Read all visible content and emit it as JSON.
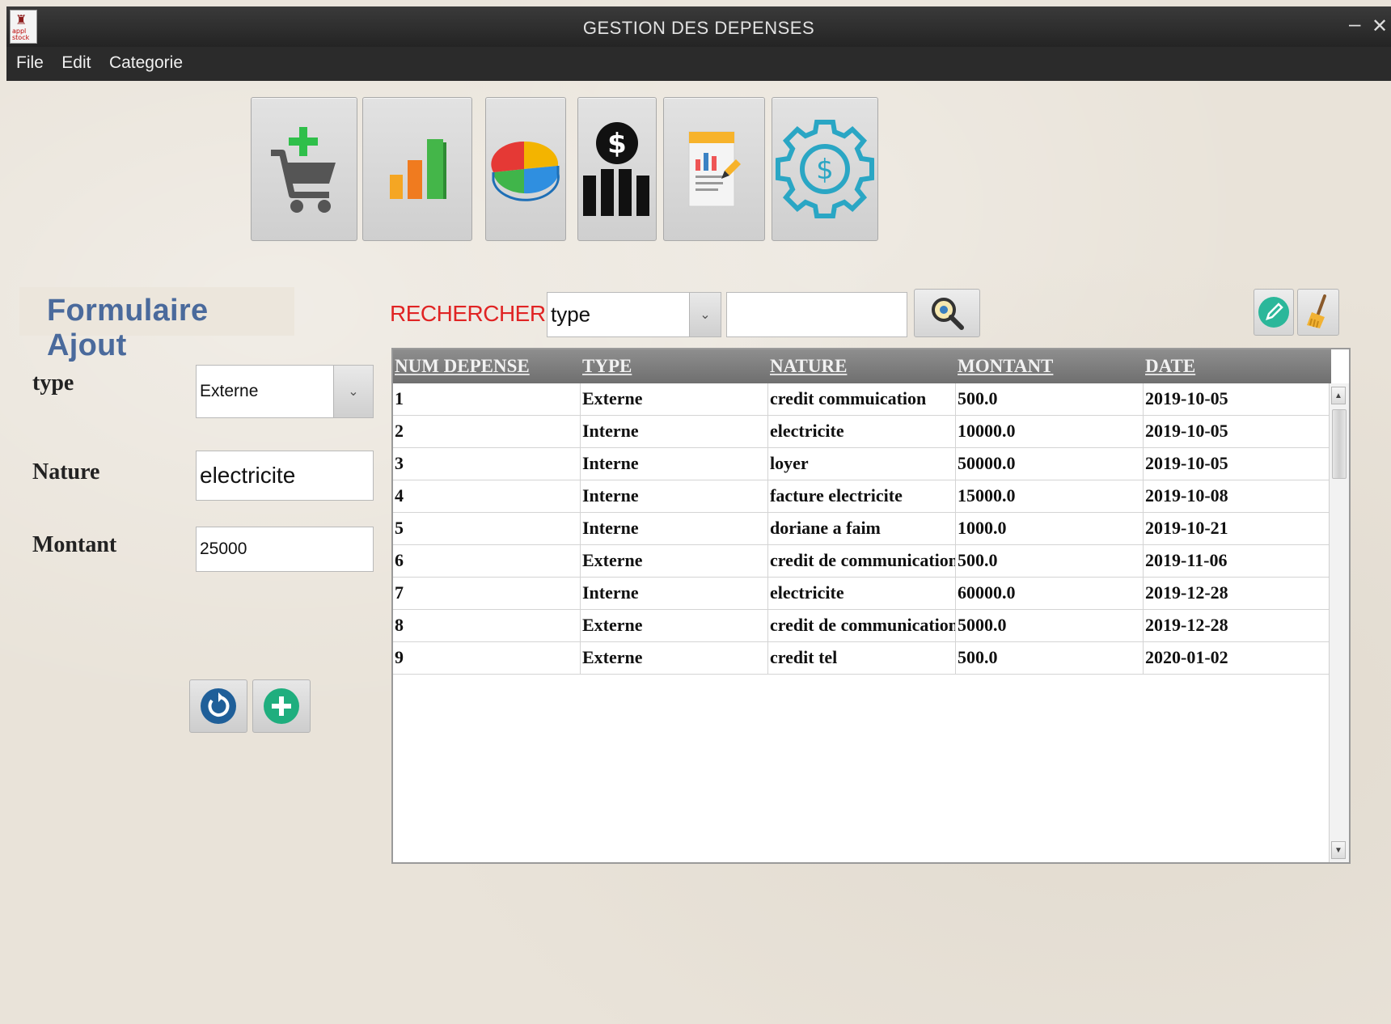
{
  "window": {
    "title": "GESTION DES DEPENSES",
    "icon_text": "appl stock",
    "minimize_glyph": "–",
    "close_glyph": "✕"
  },
  "menu": [
    "File",
    "Edit",
    "Categorie"
  ],
  "toolbar": {
    "buttons": [
      {
        "icon": "cart-add-icon"
      },
      {
        "icon": "bar-chart-icon"
      },
      {
        "icon": "pie-chart-icon"
      },
      {
        "icon": "dollar-stats-icon"
      },
      {
        "icon": "report-icon"
      },
      {
        "icon": "dollar-gear-icon"
      }
    ]
  },
  "form": {
    "title": "Formulaire Ajout",
    "type_label": "type",
    "type_value": "Externe",
    "nature_label": "Nature",
    "nature_value": "electricite",
    "montant_label": "Montant",
    "montant_value": "25000"
  },
  "search": {
    "label": "RECHERCHER PAR",
    "criteria_value": "type",
    "query_value": ""
  },
  "table": {
    "columns": [
      "NUM DEPENSE",
      "TYPE",
      "NATURE",
      "MONTANT",
      "DATE"
    ],
    "rows": [
      [
        "1",
        "Externe",
        "credit commuication",
        "500.0",
        "2019-10-05"
      ],
      [
        "2",
        "Interne",
        "electricite",
        "10000.0",
        "2019-10-05"
      ],
      [
        "3",
        "Interne",
        "loyer",
        "50000.0",
        "2019-10-05"
      ],
      [
        "4",
        "Interne",
        "facture electricite",
        "15000.0",
        "2019-10-08"
      ],
      [
        "5",
        "Interne",
        "doriane a faim",
        "1000.0",
        "2019-10-21"
      ],
      [
        "6",
        "Externe",
        "credit de communication",
        "500.0",
        "2019-11-06"
      ],
      [
        "7",
        "Interne",
        "electricite",
        "60000.0",
        "2019-12-28"
      ],
      [
        "8",
        "Externe",
        "credit de communication",
        "5000.0",
        "2019-12-28"
      ],
      [
        "9",
        "Externe",
        "credit tel",
        "500.0",
        "2020-01-02"
      ]
    ]
  },
  "colors": {
    "menubar": "#2b2b2b",
    "form_title": "#4a6a9c",
    "search_label": "#e02424",
    "table_header": "#7f7f7f"
  }
}
